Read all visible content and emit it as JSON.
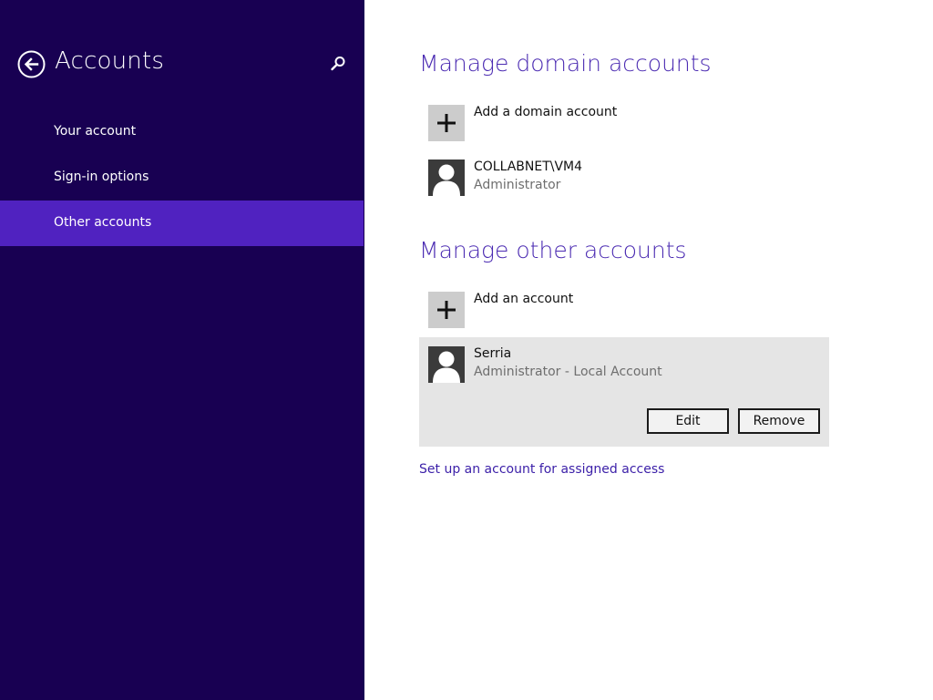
{
  "sidebar": {
    "title": "Accounts",
    "items": [
      {
        "label": "Your account",
        "selected": false
      },
      {
        "label": "Sign-in options",
        "selected": false
      },
      {
        "label": "Other accounts",
        "selected": true
      }
    ],
    "back_icon": "back-arrow-circle-icon",
    "search_icon": "search-icon"
  },
  "main": {
    "domain_section": {
      "title": "Manage domain accounts",
      "add_label": "Add a domain account",
      "accounts": [
        {
          "name": "COLLABNET\\VM4",
          "role": "Administrator"
        }
      ]
    },
    "other_section": {
      "title": "Manage other accounts",
      "add_label": "Add an account",
      "selected_account": {
        "name": "Serria",
        "role": "Administrator - Local Account",
        "edit_label": "Edit",
        "remove_label": "Remove"
      }
    },
    "assigned_access_link": "Set up an account for assigned access"
  },
  "colors": {
    "sidebar_bg": "#180052",
    "sidebar_selected": "#5022c0",
    "heading": "#4b2bb2",
    "link": "#3b1fa8"
  }
}
